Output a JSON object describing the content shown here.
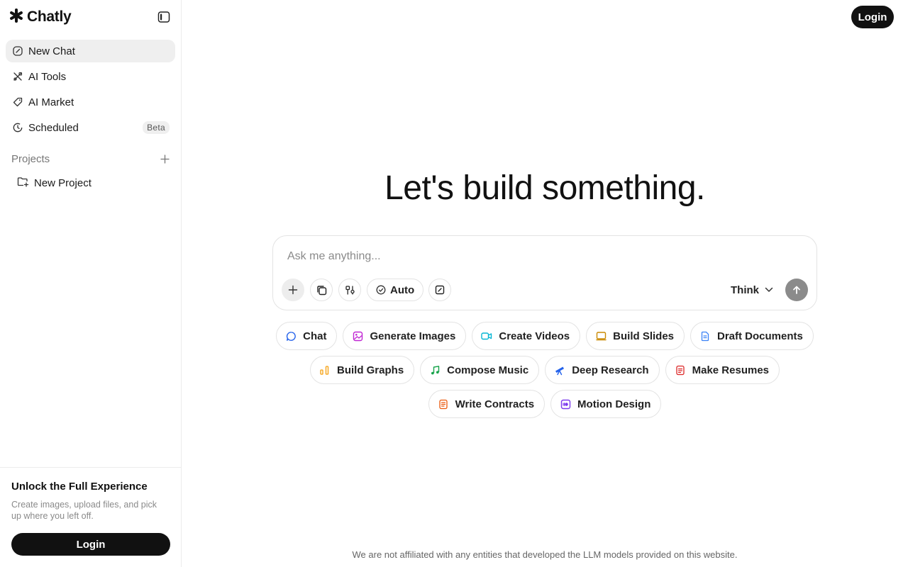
{
  "brand": {
    "name": "Chatly"
  },
  "sidebar": {
    "items": [
      {
        "label": "New Chat",
        "icon": "edit-icon",
        "active": true
      },
      {
        "label": "AI Tools",
        "icon": "tools-icon"
      },
      {
        "label": "AI Market",
        "icon": "tag-icon"
      },
      {
        "label": "Scheduled",
        "icon": "clock-icon",
        "badge": "Beta"
      }
    ],
    "projects_title": "Projects",
    "project_item": "New Project"
  },
  "unlock": {
    "title": "Unlock the Full Experience",
    "description": "Create images, upload files, and pick up where you left off.",
    "button": "Login"
  },
  "header": {
    "login": "Login"
  },
  "main": {
    "headline": "Let's build something.",
    "composer": {
      "placeholder": "Ask me anything...",
      "auto_label": "Auto",
      "think_label": "Think"
    },
    "chips": [
      [
        {
          "label": "Chat",
          "icon": "chat-bubble-icon",
          "color": "#2563eb"
        },
        {
          "label": "Generate Images",
          "icon": "image-icon",
          "color": "#c026d3"
        },
        {
          "label": "Create Videos",
          "icon": "video-icon",
          "color": "#06b6d4"
        },
        {
          "label": "Build Slides",
          "icon": "slides-icon",
          "color": "#ca8a04"
        },
        {
          "label": "Draft Documents",
          "icon": "document-icon",
          "color": "#3b82f6"
        }
      ],
      [
        {
          "label": "Build Graphs",
          "icon": "bar-chart-icon",
          "color": "#f59e0b"
        },
        {
          "label": "Compose Music",
          "icon": "music-note-icon",
          "color": "#16a34a"
        },
        {
          "label": "Deep Research",
          "icon": "telescope-icon",
          "color": "#2563eb"
        },
        {
          "label": "Make Resumes",
          "icon": "resume-icon",
          "color": "#dc2626"
        }
      ],
      [
        {
          "label": "Write Contracts",
          "icon": "contract-icon",
          "color": "#ea580c"
        },
        {
          "label": "Motion Design",
          "icon": "motion-icon",
          "color": "#7c3aed"
        }
      ]
    ],
    "disclaimer": "We are not affiliated with any entities that developed the LLM models provided on this website."
  }
}
